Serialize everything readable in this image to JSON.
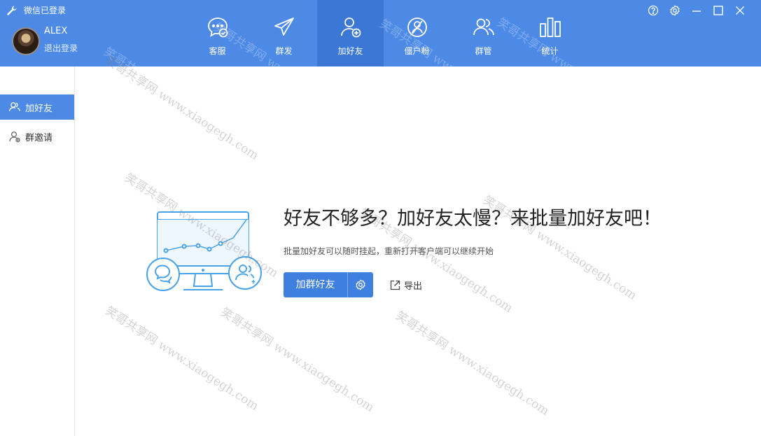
{
  "app": {
    "title": "微信已登录"
  },
  "user": {
    "name": "ALEX",
    "logout_label": "退出登录"
  },
  "nav": [
    {
      "label": "客服",
      "icon": "chat-bubble-icon"
    },
    {
      "label": "群发",
      "icon": "paper-plane-icon"
    },
    {
      "label": "加好友",
      "icon": "add-user-icon",
      "active": true
    },
    {
      "label": "僵户粉",
      "icon": "zombie-fan-icon"
    },
    {
      "label": "群管",
      "icon": "group-users-icon"
    },
    {
      "label": "统计",
      "icon": "bar-chart-icon"
    }
  ],
  "window_controls": [
    "help-icon",
    "settings-icon",
    "minimize-icon",
    "maximize-icon",
    "close-icon"
  ],
  "sidebar": {
    "items": [
      {
        "label": "加好友",
        "icon": "add-friend-icon",
        "active": true
      },
      {
        "label": "群邀请",
        "icon": "group-invite-icon",
        "active": false
      }
    ]
  },
  "main": {
    "headline": "好友不够多？加好友太慢？来批量加好友吧！",
    "subtext": "批量加好友可以随时挂起，重新打开客户端可以继续开始",
    "primary_button": "加群好友",
    "export_label": "导出"
  },
  "watermark": {
    "text": "笑哥共享网 www.xiaogegh.com"
  },
  "colors": {
    "header_bg": "#4d8ae6",
    "nav_active_bg": "#3b78d6",
    "button_bg": "#3f7fe0",
    "illustration": "#4aa3e8"
  }
}
